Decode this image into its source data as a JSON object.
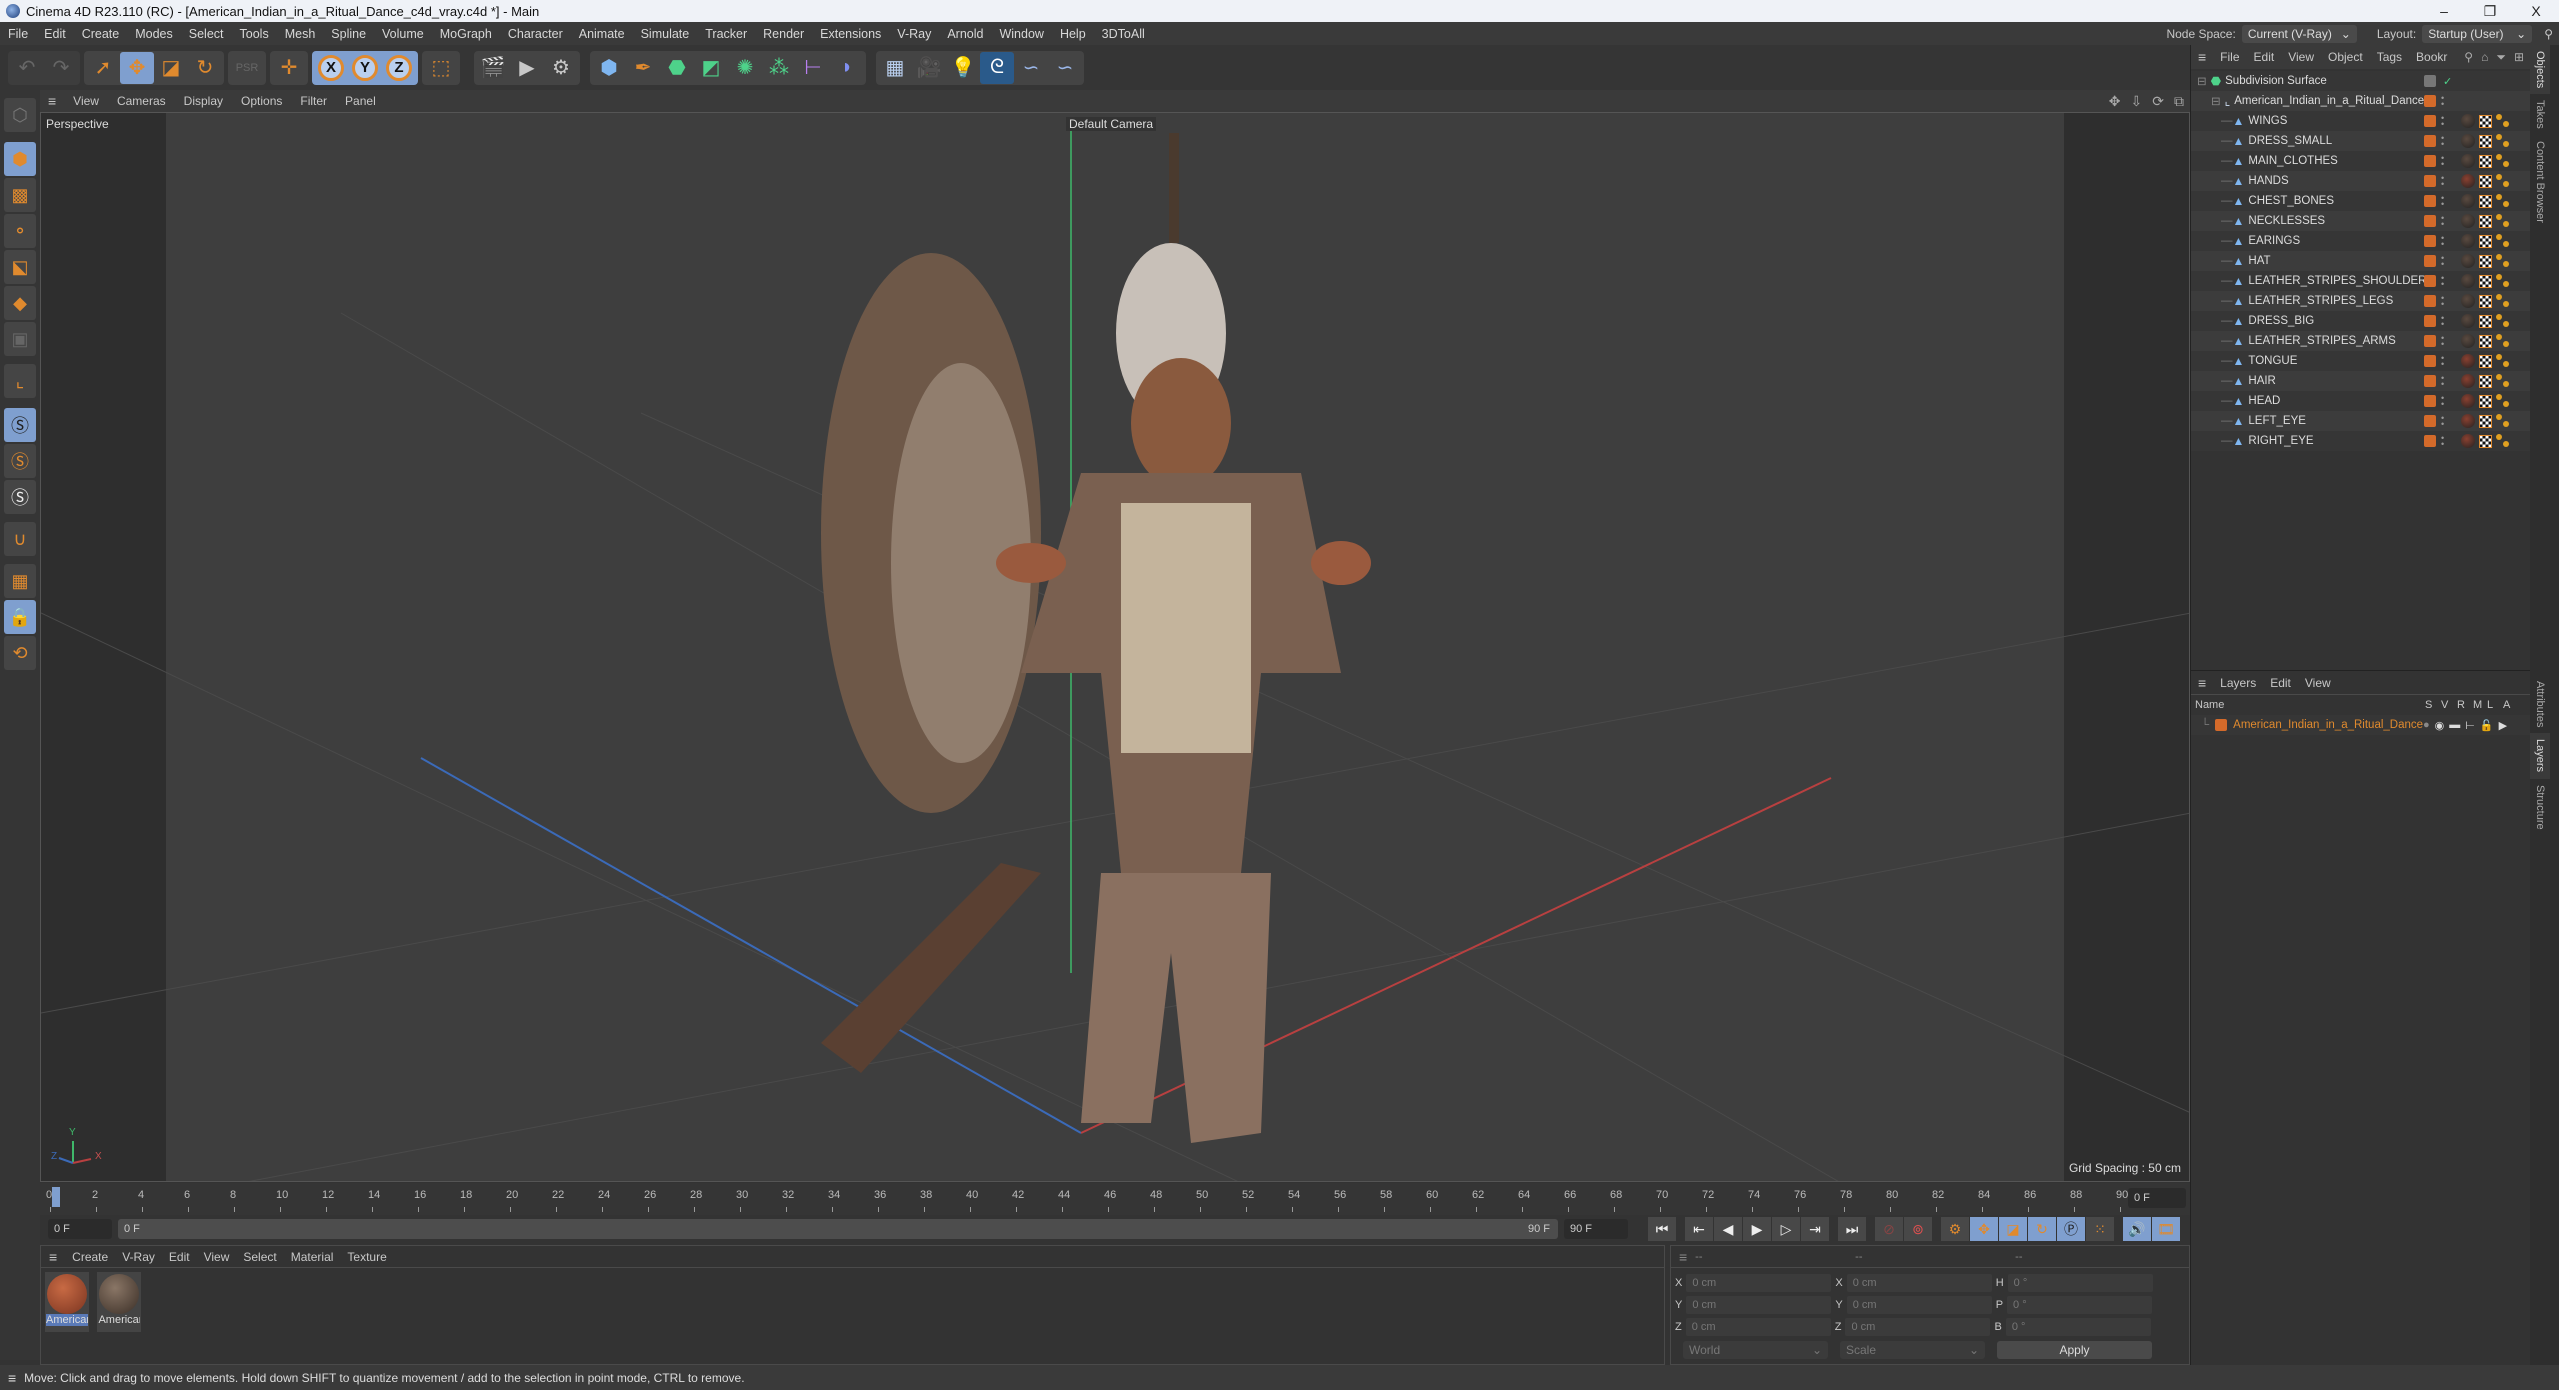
{
  "window": {
    "title": "Cinema 4D R23.110 (RC) - [American_Indian_in_a_Ritual_Dance_c4d_vray.c4d *] - Main",
    "controls": [
      "–",
      "❐",
      "X"
    ]
  },
  "menubar": {
    "items": [
      "File",
      "Edit",
      "Create",
      "Modes",
      "Select",
      "Tools",
      "Mesh",
      "Spline",
      "Volume",
      "MoGraph",
      "Character",
      "Animate",
      "Simulate",
      "Tracker",
      "Render",
      "Extensions",
      "V-Ray",
      "Arnold",
      "Window",
      "Help",
      "3DToAll"
    ],
    "node_space_label": "Node Space:",
    "node_space_value": "Current (V-Ray)",
    "layout_label": "Layout:",
    "layout_value": "Startup (User)"
  },
  "toolbar": {
    "undo": "↶",
    "redo": "↷",
    "tools": [
      {
        "name": "select-tool",
        "glyph": "➚",
        "active": false
      },
      {
        "name": "move-tool",
        "glyph": "✥",
        "active": true
      },
      {
        "name": "scale-tool",
        "glyph": "◪",
        "active": false
      },
      {
        "name": "rotate-tool",
        "glyph": "↻",
        "active": false
      }
    ],
    "axis": [
      "X",
      "Y",
      "Z"
    ]
  },
  "viewport": {
    "menu": [
      "View",
      "Cameras",
      "Display",
      "Options",
      "Filter",
      "Panel"
    ],
    "projection": "Perspective",
    "camera": "Default Camera",
    "grid_spacing": "Grid Spacing : 50 cm",
    "axes": {
      "x": "X",
      "y": "Y",
      "z": "Z"
    }
  },
  "timeline": {
    "ticks": [
      "0",
      "2",
      "4",
      "6",
      "8",
      "10",
      "12",
      "14",
      "16",
      "18",
      "20",
      "22",
      "24",
      "26",
      "28",
      "30",
      "32",
      "34",
      "36",
      "38",
      "40",
      "42",
      "44",
      "46",
      "48",
      "50",
      "52",
      "54",
      "56",
      "58",
      "60",
      "62",
      "64",
      "66",
      "68",
      "70",
      "72",
      "74",
      "76",
      "78",
      "80",
      "82",
      "84",
      "86",
      "88",
      "90"
    ],
    "current_frame": "0 F",
    "start_field": "0 F",
    "range_start": "0 F",
    "range_end": "90 F",
    "end_field": "90 F",
    "right_frame": "0 F"
  },
  "materials": {
    "menu": [
      "Create",
      "V-Ray",
      "Edit",
      "View",
      "Select",
      "Material",
      "Texture"
    ],
    "items": [
      {
        "label": "American",
        "color": "#9a4a2c",
        "selected": true
      },
      {
        "label": "American",
        "color": "#5a4a3e",
        "selected": false
      }
    ]
  },
  "coordinates": {
    "headers": [
      "--",
      "--",
      "--"
    ],
    "rows": [
      {
        "pos_label": "X",
        "pos": "0 cm",
        "size_label": "X",
        "size": "0 cm",
        "rot_label": "H",
        "rot": "0 °"
      },
      {
        "pos_label": "Y",
        "pos": "0 cm",
        "size_label": "Y",
        "size": "0 cm",
        "rot_label": "P",
        "rot": "0 °"
      },
      {
        "pos_label": "Z",
        "pos": "0 cm",
        "size_label": "Z",
        "size": "0 cm",
        "rot_label": "B",
        "rot": "0 °"
      }
    ],
    "space": "World",
    "mode": "Scale",
    "apply": "Apply"
  },
  "status": "Move: Click and drag to move elements. Hold down SHIFT to quantize movement / add to the selection in point mode, CTRL to remove.",
  "objects": {
    "menu": [
      "File",
      "Edit",
      "View",
      "Object",
      "Tags",
      "Bookr"
    ],
    "root": "Subdivision Surface",
    "group": "American_Indian_in_a_Ritual_Dance",
    "children": [
      {
        "name": "WINGS",
        "mat": "#5a4a40"
      },
      {
        "name": "DRESS_SMALL",
        "mat": "#5a4a40"
      },
      {
        "name": "MAIN_CLOTHES",
        "mat": "#5a4a40"
      },
      {
        "name": "HANDS",
        "mat": "#8a4030"
      },
      {
        "name": "CHEST_BONES",
        "mat": "#5a4a40"
      },
      {
        "name": "NECKLESSES",
        "mat": "#5a4a40"
      },
      {
        "name": "EARINGS",
        "mat": "#5a4a40"
      },
      {
        "name": "HAT",
        "mat": "#5a4a40"
      },
      {
        "name": "LEATHER_STRIPES_SHOULDERS",
        "mat": "#5a4a40"
      },
      {
        "name": "LEATHER_STRIPES_LEGS",
        "mat": "#5a4a40"
      },
      {
        "name": "DRESS_BIG",
        "mat": "#5a4a40"
      },
      {
        "name": "LEATHER_STRIPES_ARMS",
        "mat": "#5a4a40"
      },
      {
        "name": "TONGUE",
        "mat": "#8a4030"
      },
      {
        "name": "HAIR",
        "mat": "#8a4030"
      },
      {
        "name": "HEAD",
        "mat": "#8a4030"
      },
      {
        "name": "LEFT_EYE",
        "mat": "#8a4030"
      },
      {
        "name": "RIGHT_EYE",
        "mat": "#8a4030"
      }
    ]
  },
  "layers": {
    "menu": [
      "Layers",
      "Edit",
      "View"
    ],
    "columns": [
      "Name",
      "S",
      "V",
      "R",
      "M",
      "L",
      "A"
    ],
    "items": [
      {
        "name": "American_Indian_in_a_Ritual_Dance",
        "color": "#d46a2a"
      }
    ]
  },
  "side_tabs": {
    "top": [
      "Objects",
      "Takes",
      "Content Browser"
    ],
    "bottom": [
      "Attributes",
      "Layers",
      "Structure"
    ]
  },
  "colors": {
    "accent": "#e08a2e",
    "active_blue": "#7f9fcf",
    "layer_orange": "#d46a2a"
  }
}
